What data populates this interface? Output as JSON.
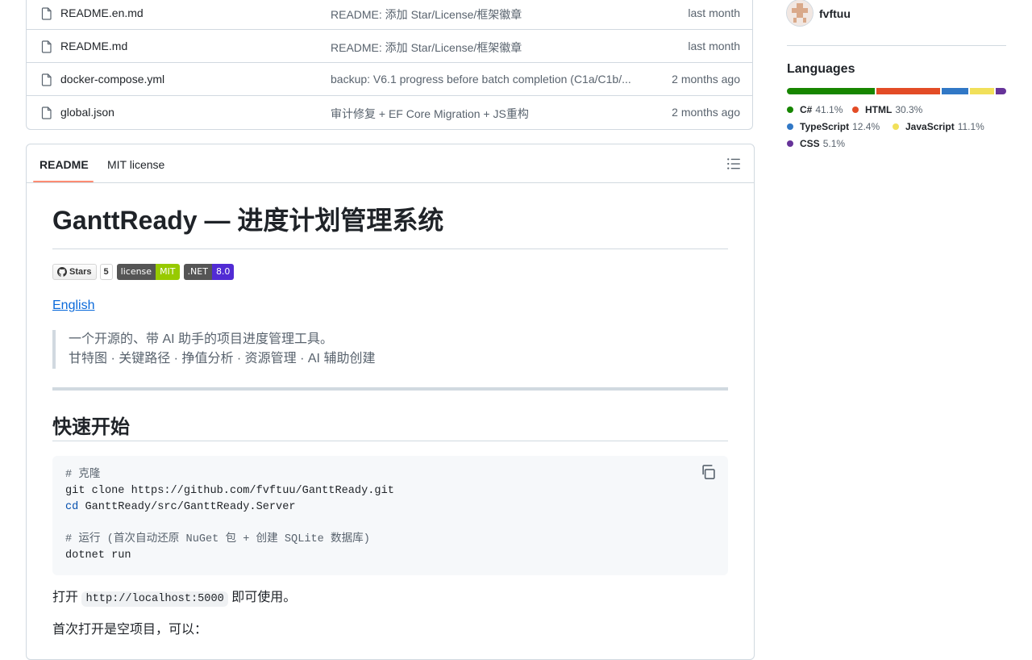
{
  "files": [
    {
      "name": "README.en.md",
      "commit": "README: 添加 Star/License/框架徽章",
      "time": "last month"
    },
    {
      "name": "README.md",
      "commit": "README: 添加 Star/License/框架徽章",
      "time": "last month"
    },
    {
      "name": "docker-compose.yml",
      "commit": "backup: V6.1 progress before batch completion (C1a/C1b/...",
      "time": "2 months ago"
    },
    {
      "name": "global.json",
      "commit": "审计修复 + EF Core Migration + JS重构",
      "time": "2 months ago"
    }
  ],
  "readme": {
    "tabs": [
      "README",
      "MIT license"
    ],
    "title": "GanttReady — 进度计划管理系统",
    "badges": {
      "stars_label": "Stars",
      "stars_count": "5",
      "license_label": "license",
      "license_value": "MIT",
      "dotnet_label": ".NET",
      "dotnet_value": "8.0"
    },
    "english_link": "English",
    "quote_line1": "一个开源的、带 AI 助手的项目进度管理工具。",
    "quote_line2": "甘特图 · 关键路径 · 挣值分析 · 资源管理 · AI 辅助创建",
    "quickstart_heading": "快速开始",
    "code": {
      "line1": "# 克隆",
      "line2": "git clone https://github.com/fvftuu/GanttReady.git",
      "line3_kw": "cd",
      "line3_rest": " GanttReady/src/GanttReady.Server",
      "line5": "# 运行 (首次自动还原 NuGet 包 + 创建 SQLite 数据库)",
      "line6": "dotnet run"
    },
    "open_prefix": "打开",
    "open_url": "http://localhost:5000",
    "open_suffix": "即可使用。",
    "first_open": "首次打开是空项目，可以："
  },
  "sidebar": {
    "contributor": "fvftuu",
    "languages_title": "Languages",
    "languages": [
      {
        "name": "C#",
        "percent": "41.1%",
        "value": 41.1,
        "color": "#178600"
      },
      {
        "name": "HTML",
        "percent": "30.3%",
        "value": 30.3,
        "color": "#e34c26"
      },
      {
        "name": "TypeScript",
        "percent": "12.4%",
        "value": 12.4,
        "color": "#3178c6"
      },
      {
        "name": "JavaScript",
        "percent": "11.1%",
        "value": 11.1,
        "color": "#f1e05a"
      },
      {
        "name": "CSS",
        "percent": "5.1%",
        "value": 5.1,
        "color": "#663399"
      }
    ]
  }
}
